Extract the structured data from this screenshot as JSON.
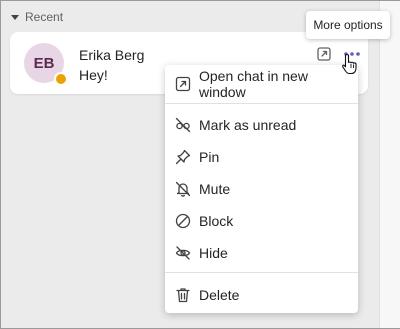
{
  "section": {
    "label": "Recent",
    "icon": "caret-down-icon"
  },
  "chat": {
    "avatar_initials": "EB",
    "name": "Erika Berg",
    "preview": "Hey!",
    "presence_color": "#eaa300",
    "avatar_bg": "#e8d6e6",
    "popout_icon": "popout-icon",
    "more_icon": "more-options-icon"
  },
  "tooltip": {
    "text": "More options"
  },
  "menu": {
    "items": [
      {
        "label": "Open chat in new window",
        "icon": "open-in-window-icon"
      },
      {
        "label": "Mark as unread",
        "icon": "eye-off-icon"
      },
      {
        "label": "Pin",
        "icon": "pin-icon"
      },
      {
        "label": "Mute",
        "icon": "bell-off-icon"
      },
      {
        "label": "Block",
        "icon": "block-icon"
      },
      {
        "label": "Hide",
        "icon": "hide-icon"
      },
      {
        "label": "Delete",
        "icon": "delete-icon"
      }
    ]
  },
  "colors": {
    "accent": "#5b5fc7",
    "background": "#ebebeb",
    "card": "#ffffff"
  }
}
